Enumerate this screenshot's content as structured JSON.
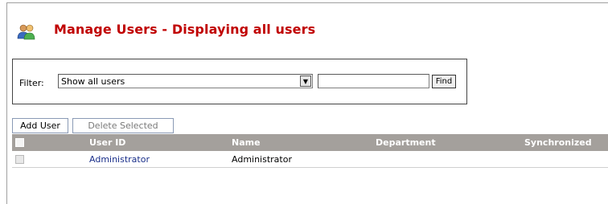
{
  "page": {
    "title": "Manage Users - Displaying all users"
  },
  "filter": {
    "label": "Filter:",
    "selected": "Show all users",
    "search_value": "",
    "find_label": "Find"
  },
  "toolbar": {
    "add_label": "Add User",
    "delete_label": "Delete Selected"
  },
  "table": {
    "columns": [
      "User ID",
      "Name",
      "Department",
      "Synchronized"
    ],
    "rows": [
      {
        "user_id": "Administrator",
        "name": "Administrator",
        "department": "",
        "synchronized": ""
      }
    ]
  },
  "colors": {
    "title": "#c00000",
    "header_bg": "#a4a09c",
    "link": "#1a2f8a"
  },
  "icons": {
    "page": "users-icon",
    "dropdown": "chevron-down-icon"
  }
}
